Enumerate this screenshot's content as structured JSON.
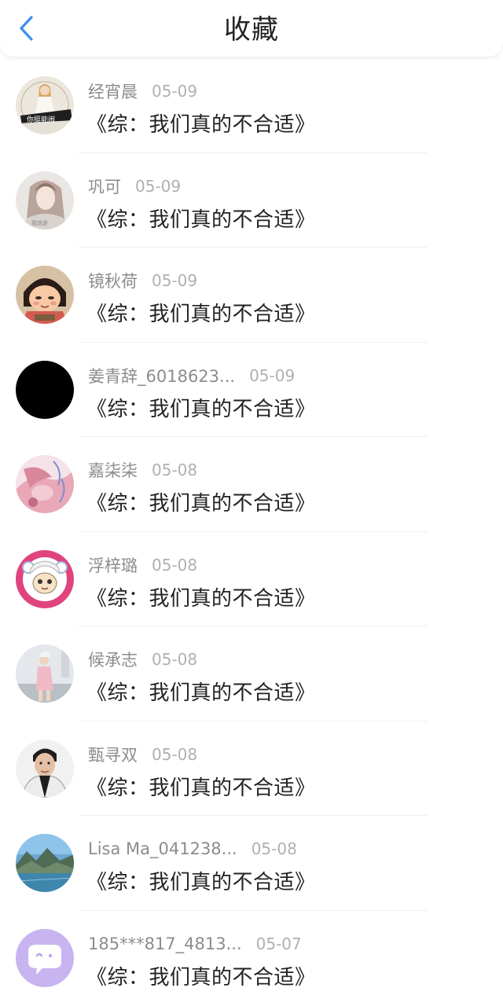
{
  "header": {
    "title": "收藏",
    "back_icon": "chevron-left-icon",
    "accent_color": "#3a8ff0"
  },
  "items": [
    {
      "name": "经宵晨",
      "date": "05-09",
      "book": "《综：我们真的不合适》",
      "avatar_icon": "avatar-photo-girl-white-dress"
    },
    {
      "name": "巩可",
      "date": "05-09",
      "book": "《综：我们真的不合适》",
      "avatar_icon": "avatar-photo-girl-hair"
    },
    {
      "name": "镜秋荷",
      "date": "05-09",
      "book": "《综：我们真的不合适》",
      "avatar_icon": "avatar-cartoon-girl"
    },
    {
      "name": "姜青辞_6018623...",
      "date": "05-09",
      "book": "《综：我们真的不合适》",
      "avatar_icon": "avatar-black-circle"
    },
    {
      "name": "嘉柒柒",
      "date": "05-08",
      "book": "《综：我们真的不合适》",
      "avatar_icon": "avatar-pink-illustration"
    },
    {
      "name": "浮梓璐",
      "date": "05-08",
      "book": "《综：我们真的不合适》",
      "avatar_icon": "avatar-sheep-cartoon"
    },
    {
      "name": "候承志",
      "date": "05-08",
      "book": "《综：我们真的不合适》",
      "avatar_icon": "avatar-photo-girl-pink"
    },
    {
      "name": "甄寻双",
      "date": "05-08",
      "book": "《综：我们真的不合适》",
      "avatar_icon": "avatar-photo-man"
    },
    {
      "name": "Lisa Ma_041238...",
      "date": "05-08",
      "book": "《综：我们真的不合适》",
      "avatar_icon": "avatar-landscape-lake"
    },
    {
      "name": "185***817_4813...",
      "date": "05-07",
      "book": "《综：我们真的不合适》",
      "avatar_icon": "avatar-default-purple-chat"
    }
  ]
}
